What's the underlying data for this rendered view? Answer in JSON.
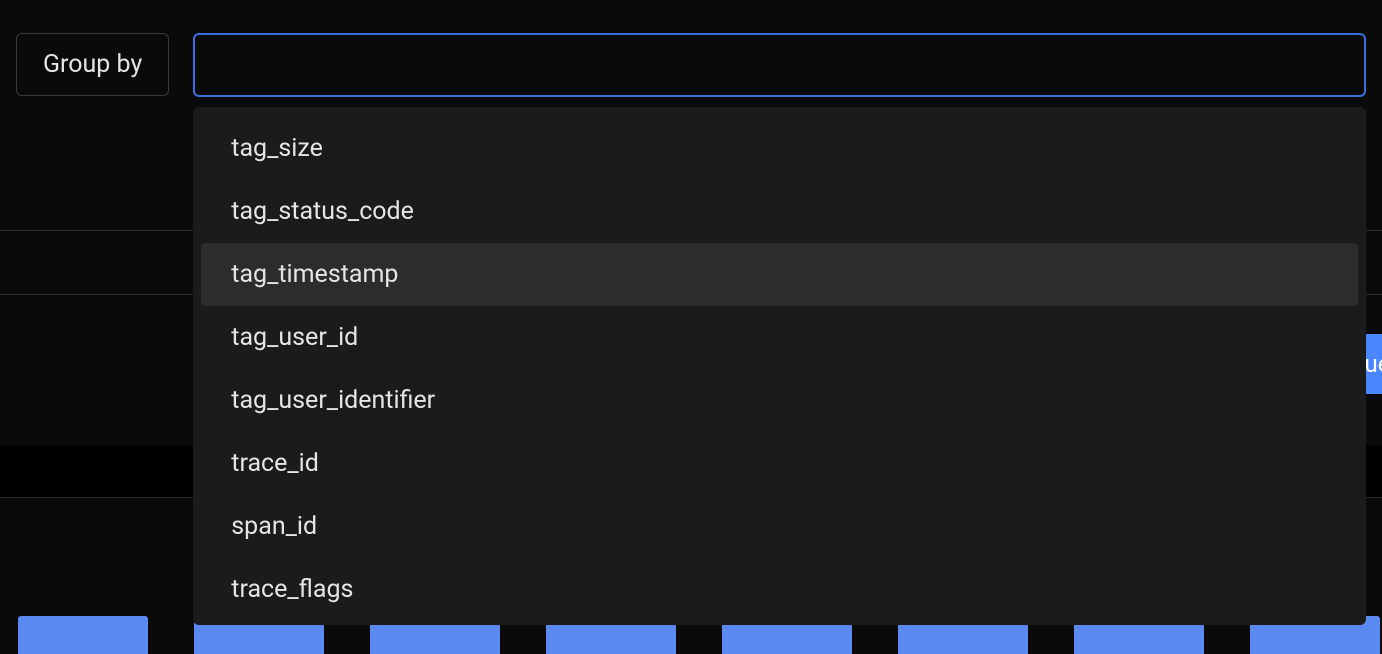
{
  "groupBy": {
    "label": "Group by",
    "inputValue": "",
    "placeholder": "",
    "options": [
      "tag_size",
      "tag_status_code",
      "tag_timestamp",
      "tag_user_id",
      "tag_user_identifier",
      "trace_id",
      "span_id",
      "trace_flags"
    ],
    "highlightedIndex": 2
  },
  "sideButton": {
    "label": "Que"
  }
}
